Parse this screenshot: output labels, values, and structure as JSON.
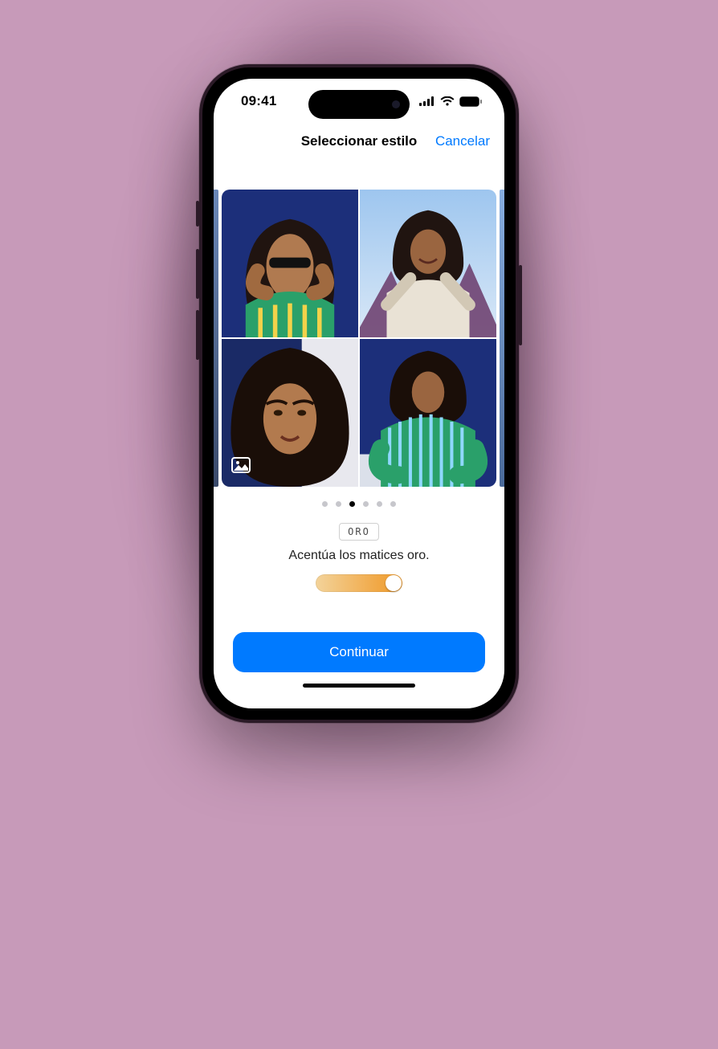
{
  "status": {
    "time": "09:41",
    "icons": {
      "signal": "cellular-icon",
      "wifi": "wifi-icon",
      "battery": "battery-icon"
    }
  },
  "nav": {
    "title": "Seleccionar estilo",
    "cancel": "Cancelar"
  },
  "carousel": {
    "page_count": 6,
    "active_index": 2
  },
  "style": {
    "name": "ORO",
    "description": "Acentúa los matices oro."
  },
  "cta": {
    "label": "Continuar"
  }
}
